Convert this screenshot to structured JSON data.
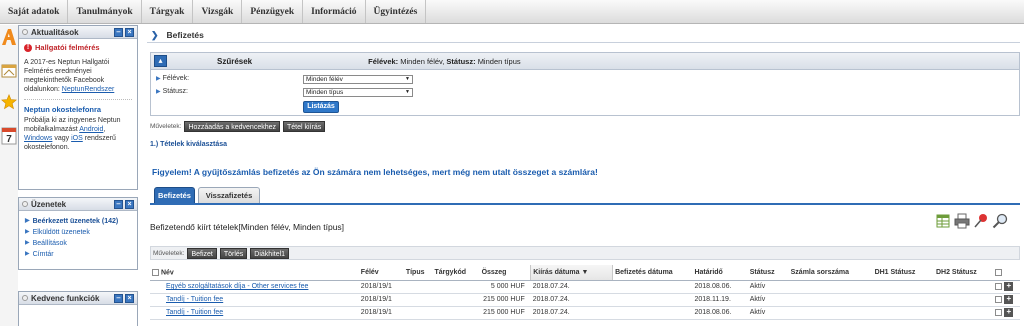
{
  "topmenu": [
    "Saját adatok",
    "Tanulmányok",
    "Tárgyak",
    "Vizsgák",
    "Pénzügyek",
    "Információ",
    "Ügyintézés"
  ],
  "news": {
    "title": "Aktualitások",
    "item1_title": "Hallgatói felmérés",
    "item1_text": "A 2017-es Neptun Hallgatói Felmérés eredményei megtekinthetők Facebook oldalunkon:",
    "item1_link": "NeptunRendszer",
    "item2_title": "Neptun okostelefonra",
    "item2_text_a": "Próbálja ki az ingyenes Neptun mobilalkalmazást",
    "item2_link1": "Android",
    "item2_comma": ",",
    "item2_link2": "Windows",
    "item2_text_b": "vagy",
    "item2_link3": "iOS",
    "item2_text_c": "rendszerű okostelefonon."
  },
  "messages": {
    "title": "Üzenetek",
    "items": [
      "Beérkezett üzenetek (142)",
      "Elküldött üzenetek",
      "Beállítások",
      "Címtár"
    ]
  },
  "favorites": {
    "title": "Kedvenc funkciók"
  },
  "page": {
    "title": "Befizetés"
  },
  "filters": {
    "header": "Szűrések",
    "summary_label1": "Félévek:",
    "summary_value1": "Minden félév,",
    "summary_label2": "Státusz:",
    "summary_value2": "Minden típus",
    "semester_label": "Félévek:",
    "semester_value": "Minden félév",
    "status_label": "Státusz:",
    "status_value": "Minden típus",
    "list_button": "Listázás"
  },
  "ops1": {
    "label": "Műveletek:",
    "buttons": [
      "Hozzáadás a kedvencekhez",
      "Tétel kiírás"
    ]
  },
  "section1": "1.) Tételek kiválasztása",
  "warning": "Figyelem! A gyűjtőszámlás befizetés az Ön számára nem lehetséges, mert még nem utalt összeget a számlára!",
  "tabs": [
    "Befizetés",
    "Visszafizetés"
  ],
  "list_title": "Befizetendő kiírt tételek[Minden félév, Minden típus]",
  "tool_icons": [
    "excel-export-icon",
    "print-icon",
    "pin-icon",
    "search-icon"
  ],
  "ops2": {
    "label": "Műveletek:",
    "buttons": [
      "Befizet",
      "Törlés",
      "Diákhitel1"
    ]
  },
  "table": {
    "headers": [
      "Név",
      "Félév",
      "Típus",
      "Tárgykód",
      "Összeg",
      "Kiírás dátuma",
      "Befizetés dátuma",
      "Határidő",
      "Státusz",
      "Számla sorszáma",
      "DH1 Státusz",
      "DH2 Státusz"
    ],
    "rows": [
      {
        "name": "Egyéb szolgáltatások díja - Other services fee",
        "semester": "2018/19/1",
        "type": "",
        "code": "",
        "amount": "5 000 HUF",
        "issued": "2018.07.24.",
        "paid": "",
        "deadline": "2018.08.06.",
        "status": "Aktív",
        "invoice": "",
        "dh1": "",
        "dh2": ""
      },
      {
        "name": "Tandíj - Tuition fee",
        "semester": "2018/19/1",
        "type": "",
        "code": "",
        "amount": "215 000 HUF",
        "issued": "2018.07.24.",
        "paid": "",
        "deadline": "2018.11.19.",
        "status": "Aktív",
        "invoice": "",
        "dh1": "",
        "dh2": ""
      },
      {
        "name": "Tandíj - Tuition fee",
        "semester": "2018/19/1",
        "type": "",
        "code": "",
        "amount": "215 000 HUF",
        "issued": "2018.07.24.",
        "paid": "",
        "deadline": "2018.08.06.",
        "status": "Aktív",
        "invoice": "",
        "dh1": "",
        "dh2": ""
      }
    ]
  }
}
